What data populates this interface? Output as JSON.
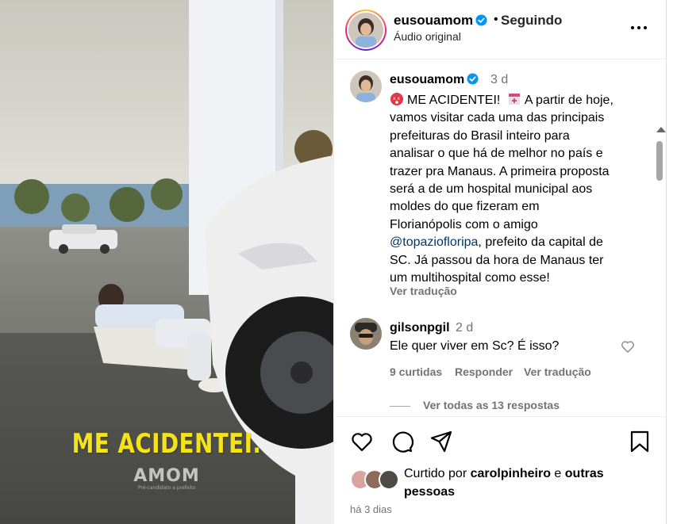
{
  "media": {
    "overlay_text": "ME ACIDENTEI.",
    "watermark": "AMOM",
    "watermark_sub": "Pré-candidato a prefeito"
  },
  "header": {
    "username": "eusouamom",
    "separator": "•",
    "follow_status": "Seguindo",
    "audio": "Áudio original",
    "more_icon": "more-horizontal-icon"
  },
  "caption": {
    "username": "eusouamom",
    "time": "3 d",
    "lines": [
      "ME ACIDENTEI!",
      "vamos visitar cada uma das principais",
      "prefeituras do Brasil inteiro para",
      "analisar o que há de melhor no país e",
      "trazer pra Manaus. A primeira proposta",
      "será a de um hospital municipal aos",
      "moldes do que fizeram em",
      "Florianópolis com o amigo",
      "prefeito da capital de",
      "SC. Já passou da hora de Manaus ter",
      "um multihospital como esse!"
    ],
    "line1_tail": "A partir de hoje,",
    "mention": "@topazioflori pa",
    "translate": "Ver tradução"
  },
  "comment": {
    "username": "gilsonpgil",
    "time": "2 d",
    "text": "Ele quer viver em Sc? É isso?",
    "likes": "9 curtidas",
    "reply": "Responder",
    "translate": "Ver tradução",
    "view_replies": "Ver todas as 13 respostas"
  },
  "actions": {
    "icons": [
      "heart-icon",
      "comment-icon",
      "share-icon",
      "bookmark-icon"
    ],
    "liked_by_prefix": "Curtido por",
    "liked_by_user": "carolpinheiro",
    "liked_by_and": "e",
    "liked_by_others": "outras",
    "liked_by_others2": "pessoas",
    "date": "há 3 dias"
  },
  "colors": {
    "caption_yellow": "#f4e21a",
    "verified_blue": "#0095f6",
    "mention_blue": "#00376b",
    "secondary_text": "#737373"
  }
}
